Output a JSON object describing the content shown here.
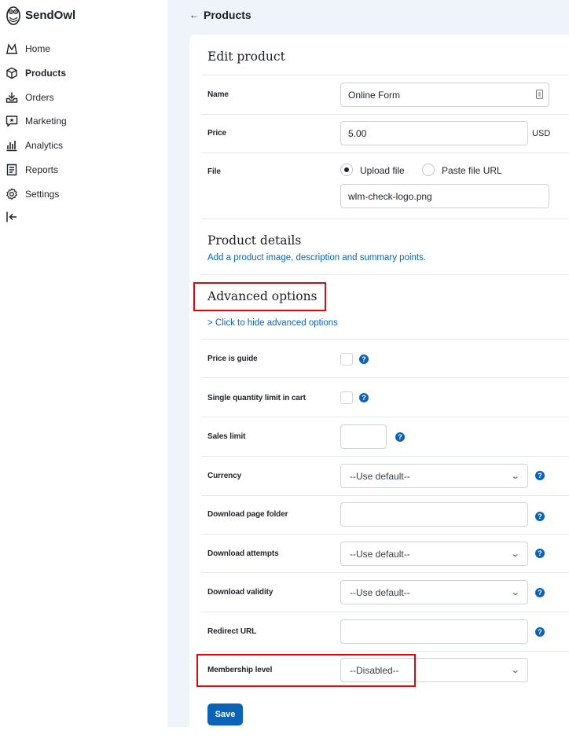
{
  "app": {
    "name": "SendOwl"
  },
  "sidebar": {
    "items": [
      {
        "label": "Home",
        "icon": "home-icon"
      },
      {
        "label": "Products",
        "icon": "products-icon",
        "active": true
      },
      {
        "label": "Orders",
        "icon": "orders-icon"
      },
      {
        "label": "Marketing",
        "icon": "marketing-icon"
      },
      {
        "label": "Analytics",
        "icon": "analytics-icon"
      },
      {
        "label": "Reports",
        "icon": "reports-icon"
      },
      {
        "label": "Settings",
        "icon": "settings-icon"
      }
    ],
    "logout_icon": "logout-icon"
  },
  "header": {
    "back_label": "Products"
  },
  "form": {
    "title": "Edit product",
    "name_label": "Name",
    "name_value": "Online Form",
    "price_label": "Price",
    "price_value": "5.00",
    "price_currency": "USD",
    "file_label": "File",
    "file_option_upload": "Upload file",
    "file_option_paste": "Paste file URL",
    "file_selected": "upload",
    "file_value": "wlm-check-logo.png",
    "details_title": "Product details",
    "details_link": "Add a product image, description and summary points.",
    "advanced_title": "Advanced options",
    "advanced_toggle": "> Click to hide advanced options",
    "price_is_guide_label": "Price is guide",
    "price_is_guide_checked": false,
    "single_qty_label": "Single quantity limit in cart",
    "single_qty_checked": false,
    "sales_limit_label": "Sales limit",
    "sales_limit_value": "",
    "currency_label": "Currency",
    "currency_value": "--Use default--",
    "download_folder_label": "Download page folder",
    "download_folder_value": "",
    "download_attempts_label": "Download attempts",
    "download_attempts_value": "--Use default--",
    "download_validity_label": "Download validity",
    "download_validity_value": "--Use default--",
    "redirect_label": "Redirect URL",
    "redirect_value": "",
    "membership_label": "Membership level",
    "membership_value": "--Disabled--",
    "save_label": "Save",
    "help_glyph": "?"
  },
  "colors": {
    "accent": "#0b63b8",
    "highlight": "#e0060d",
    "main_bg": "#eef4f9"
  }
}
